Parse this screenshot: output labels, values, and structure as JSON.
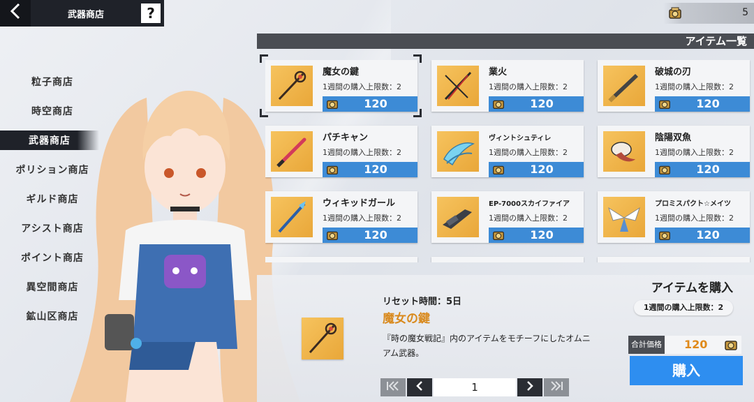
{
  "header": {
    "back_icon": "chevron-left-icon",
    "title": "武器商店",
    "help_label": "?",
    "currency_icon": "crate-coin-icon",
    "currency_count": "5"
  },
  "nav": {
    "items": [
      {
        "label": "粒子商店",
        "active": false
      },
      {
        "label": "時空商店",
        "active": false
      },
      {
        "label": "武器商店",
        "active": true
      },
      {
        "label": "ポリション商店",
        "active": false
      },
      {
        "label": "ギルド商店",
        "active": false
      },
      {
        "label": "アシスト商店",
        "active": false
      },
      {
        "label": "ポイント商店",
        "active": false
      },
      {
        "label": "異空間商店",
        "active": false
      },
      {
        "label": "鉱山区商店",
        "active": false
      }
    ]
  },
  "list": {
    "header": "アイテム一覧",
    "items": [
      {
        "name": "魔女の鍵",
        "limit": "1週間の購入上限数：2",
        "price": "120",
        "selected": true
      },
      {
        "name": "業火",
        "limit": "1週間の購入上限数：2",
        "price": "120"
      },
      {
        "name": "破城の刃",
        "limit": "1週間の購入上限数：2",
        "price": "120"
      },
      {
        "name": "パチキャン",
        "limit": "1週間の購入上限数：2",
        "price": "120"
      },
      {
        "name": "ヴィントシュティレ",
        "limit": "1週間の購入上限数：2",
        "price": "120"
      },
      {
        "name": "陰陽双魚",
        "limit": "1週間の購入上限数：2",
        "price": "120"
      },
      {
        "name": "ウィキッドガール",
        "limit": "1週間の購入上限数：2",
        "price": "120"
      },
      {
        "name": "EP-7000スカイファイア",
        "limit": "1週間の購入上限数：2",
        "price": "120"
      },
      {
        "name": "プロミスパクト☆メイツ",
        "limit": "1週間の購入上限数：2",
        "price": "120"
      }
    ]
  },
  "detail": {
    "reset_time": "リセット時間：5日",
    "name": "魔女の鍵",
    "description": "『時の魔女戦記』内のアイテムをモチーフにしたオムニアム武器。"
  },
  "pager": {
    "first": "|<<",
    "prev": "<",
    "page": "1",
    "next": ">",
    "last": ">>|"
  },
  "purchase": {
    "title": "アイテムを購入",
    "limit": "1週間の購入上限数：2",
    "total_label": "合計価格",
    "total_value": "120",
    "buy_label": "購入"
  },
  "colors": {
    "accent_blue": "#3d8bd6",
    "buy_blue": "#2e8ef0",
    "highlight_orange": "#d98a1e",
    "dark_panel": "#1f2229"
  }
}
